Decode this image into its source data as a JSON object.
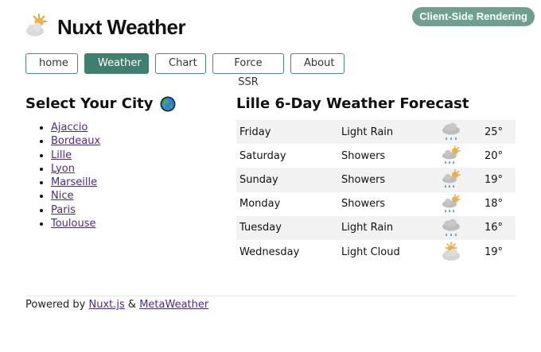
{
  "header": {
    "title": "Nuxt Weather",
    "badge": "Client-Side Rendering",
    "logo_icon": "sun-behind-cloud-icon"
  },
  "nav": {
    "items": [
      {
        "label": "home",
        "active": false
      },
      {
        "label": "Weather",
        "active": true
      },
      {
        "label": "Chart",
        "active": false
      },
      {
        "label": "Force SSR",
        "active": false
      },
      {
        "label": "About",
        "active": false
      }
    ]
  },
  "cities": {
    "title": "Select Your City",
    "title_icon": "globe-icon",
    "items": [
      "Ajaccio",
      "Bordeaux",
      "Lille",
      "Lyon",
      "Marseille",
      "Nice",
      "Paris",
      "Toulouse"
    ]
  },
  "forecast": {
    "title": "Lille 6-Day Weather Forecast",
    "rows": [
      {
        "day": "Friday",
        "condition": "Light Rain",
        "icon": "light-rain-icon",
        "temp": "25°"
      },
      {
        "day": "Saturday",
        "condition": "Showers",
        "icon": "showers-icon",
        "temp": "20°"
      },
      {
        "day": "Sunday",
        "condition": "Showers",
        "icon": "showers-icon",
        "temp": "19°"
      },
      {
        "day": "Monday",
        "condition": "Showers",
        "icon": "showers-icon",
        "temp": "18°"
      },
      {
        "day": "Tuesday",
        "condition": "Light Rain",
        "icon": "light-rain-icon",
        "temp": "16°"
      },
      {
        "day": "Wednesday",
        "condition": "Light Cloud",
        "icon": "light-cloud-icon",
        "temp": "19°"
      }
    ]
  },
  "footer": {
    "prefix": "Powered by",
    "link1": "Nuxt.js",
    "separator": "&",
    "link2": "MetaWeather"
  },
  "colors": {
    "accent": "#3f7f70",
    "badge": "#6fa08f",
    "link": "#4b2a8c"
  }
}
